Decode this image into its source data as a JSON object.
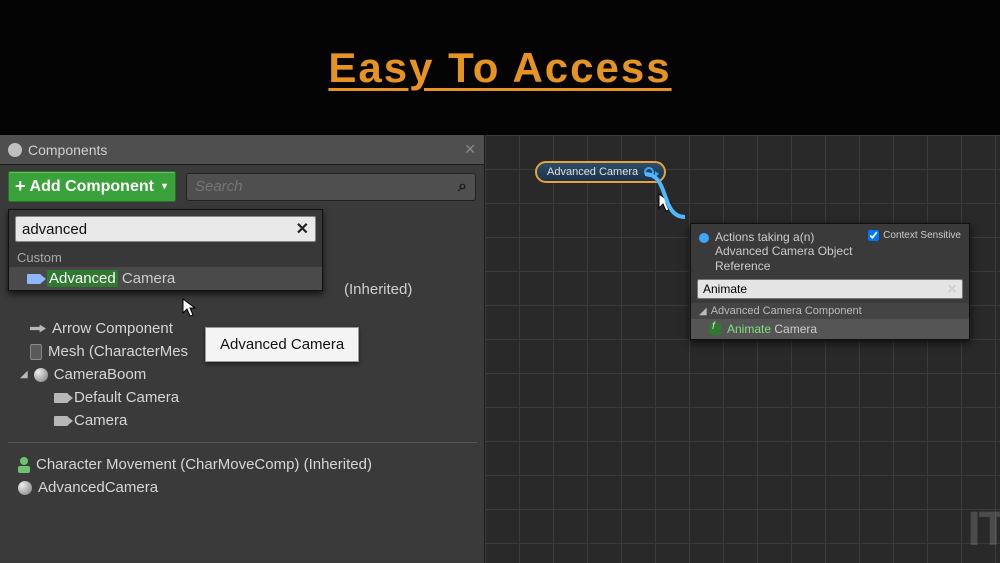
{
  "header": {
    "title": "Easy To Access"
  },
  "components_panel": {
    "tab_label": "Components",
    "add_button": "Add Component",
    "search_placeholder": "Search"
  },
  "add_dropdown": {
    "query": "advanced",
    "section_label": "Custom",
    "result_highlight": "Advanced",
    "result_rest": " Camera",
    "tooltip": "Advanced Camera"
  },
  "hierarchy": {
    "arrow_label": "Arrow Component",
    "inherited_suffix": "(Inherited)",
    "mesh_label": "Mesh (CharacterMes",
    "boom_label": "CameraBoom",
    "default_cam": "Default Camera",
    "camera": "Camera",
    "char_move": "Character Movement (CharMoveComp) (Inherited)",
    "adv_cam": "AdvancedCamera"
  },
  "graph": {
    "node_label": "Advanced Camera",
    "context_menu": {
      "title": "Actions taking a(n) Advanced Camera Object Reference",
      "context_sensitive_label": "Context Sensitive",
      "query": "Animate",
      "category": "Advanced Camera Component",
      "item_highlight": "Animate",
      "item_rest": " Camera"
    }
  },
  "watermark": "IT"
}
